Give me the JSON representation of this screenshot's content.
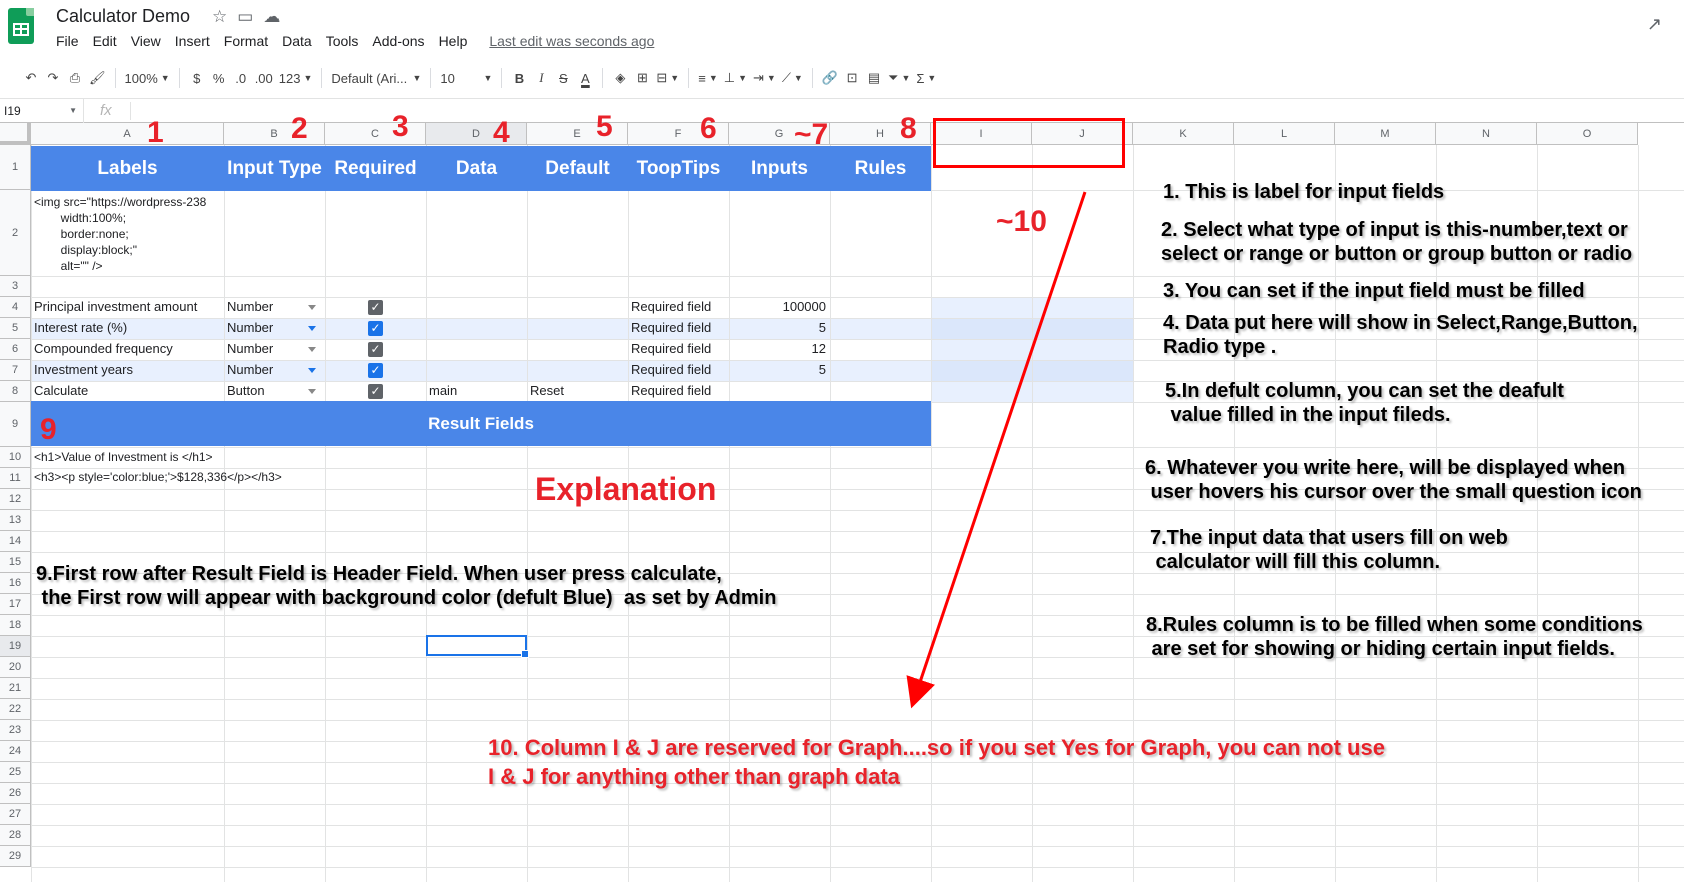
{
  "app": {
    "title": "Calculator Demo",
    "menu": [
      "File",
      "Edit",
      "View",
      "Insert",
      "Format",
      "Data",
      "Tools",
      "Add-ons",
      "Help"
    ],
    "last_edit": "Last edit was seconds ago"
  },
  "toolbar": {
    "zoom": "100%",
    "currency": "$",
    "percent": "%",
    "dec_decrease": ".0",
    "dec_increase": ".00",
    "more_formats": "123",
    "font": "Default (Ari...",
    "font_size": "10",
    "bold": "B",
    "italic": "I",
    "strike": "S",
    "text_color": "A",
    "sigma": "Σ"
  },
  "formula_bar": {
    "name_box": "I19",
    "fx": "fx"
  },
  "columns": [
    "A",
    "B",
    "C",
    "D",
    "E",
    "F",
    "G",
    "H",
    "I",
    "J",
    "K",
    "L",
    "M",
    "N",
    "O"
  ],
  "rows": [
    "1",
    "2",
    "3",
    "4",
    "5",
    "6",
    "7",
    "8",
    "9",
    "10",
    "11",
    "12",
    "13",
    "14",
    "15",
    "16",
    "17",
    "18",
    "19",
    "20",
    "21",
    "22",
    "23",
    "24",
    "25",
    "26",
    "27",
    "28",
    "29"
  ],
  "header_row": [
    "Labels",
    "Input Type",
    "Required",
    "Data",
    "Default",
    "ToopTips",
    "Inputs",
    "Rules"
  ],
  "image_cell": "<img src=\"https://wordpress-238\n        width:100%;\n        border:none;\n        display:block;\"\n        alt=\"\" />",
  "data_rows": [
    {
      "label": "Principal investment amount",
      "type": "Number",
      "data": "",
      "default": "",
      "tooltip": "Required field",
      "input": "100000"
    },
    {
      "label": "Interest rate (%)",
      "type": "Number",
      "data": "",
      "default": "",
      "tooltip": "Required field",
      "input": "5"
    },
    {
      "label": "Compounded frequency",
      "type": "Number",
      "data": "",
      "default": "",
      "tooltip": "Required field",
      "input": "12"
    },
    {
      "label": "Investment years",
      "type": "Number",
      "data": "",
      "default": "",
      "tooltip": "Required field",
      "input": "5"
    },
    {
      "label": "Calculate",
      "type": "Button",
      "data": "main",
      "default": "Reset",
      "tooltip": "Required field",
      "input": ""
    }
  ],
  "result_fields": "Result  Fields",
  "result_rows": [
    "<h1>Value of Investment is </h1>",
    "<h3><p style='color:blue;'>$128,336</p></h3>"
  ],
  "annotations": {
    "explanation_title": "Explanation",
    "col_numbers": [
      "1",
      "2",
      "3",
      "4",
      "5",
      "6",
      "7",
      "8"
    ],
    "marker_7": "~7",
    "marker_9": "9",
    "marker_10": "~10",
    "notes": [
      "1. This is label for input fields",
      "2. Select what type of input is this-number,text or\nselect or range or button or group button or radio",
      "3. You can set if the input field must be filled",
      "4. Data put here will show in Select,Range,Button,\nRadio type .",
      "5.In defult column, you can set the deafult\n value filled in the input fileds.",
      "6. Whatever you write here, will be displayed when\n user hovers his cursor over the small question icon",
      "7.The input data that users fill on web\n calculator will fill this column.",
      "8.Rules column is to be filled when some conditions\n are set for showing or hiding certain input fields.",
      "9.First row after Result Field is Header Field. When user press calculate,\n the First row will appear with background color (defult Blue)  as set by Admin",
      "10. Column I & J are reserved for Graph....so if you set Yes for Graph, you can not use\nI & J for anything other than graph data"
    ]
  },
  "colors": {
    "header_blue": "#4a86e8",
    "annotation_red": "#e8222a",
    "selection_blue": "#1a73e8",
    "logo_green": "#0f9d58"
  }
}
